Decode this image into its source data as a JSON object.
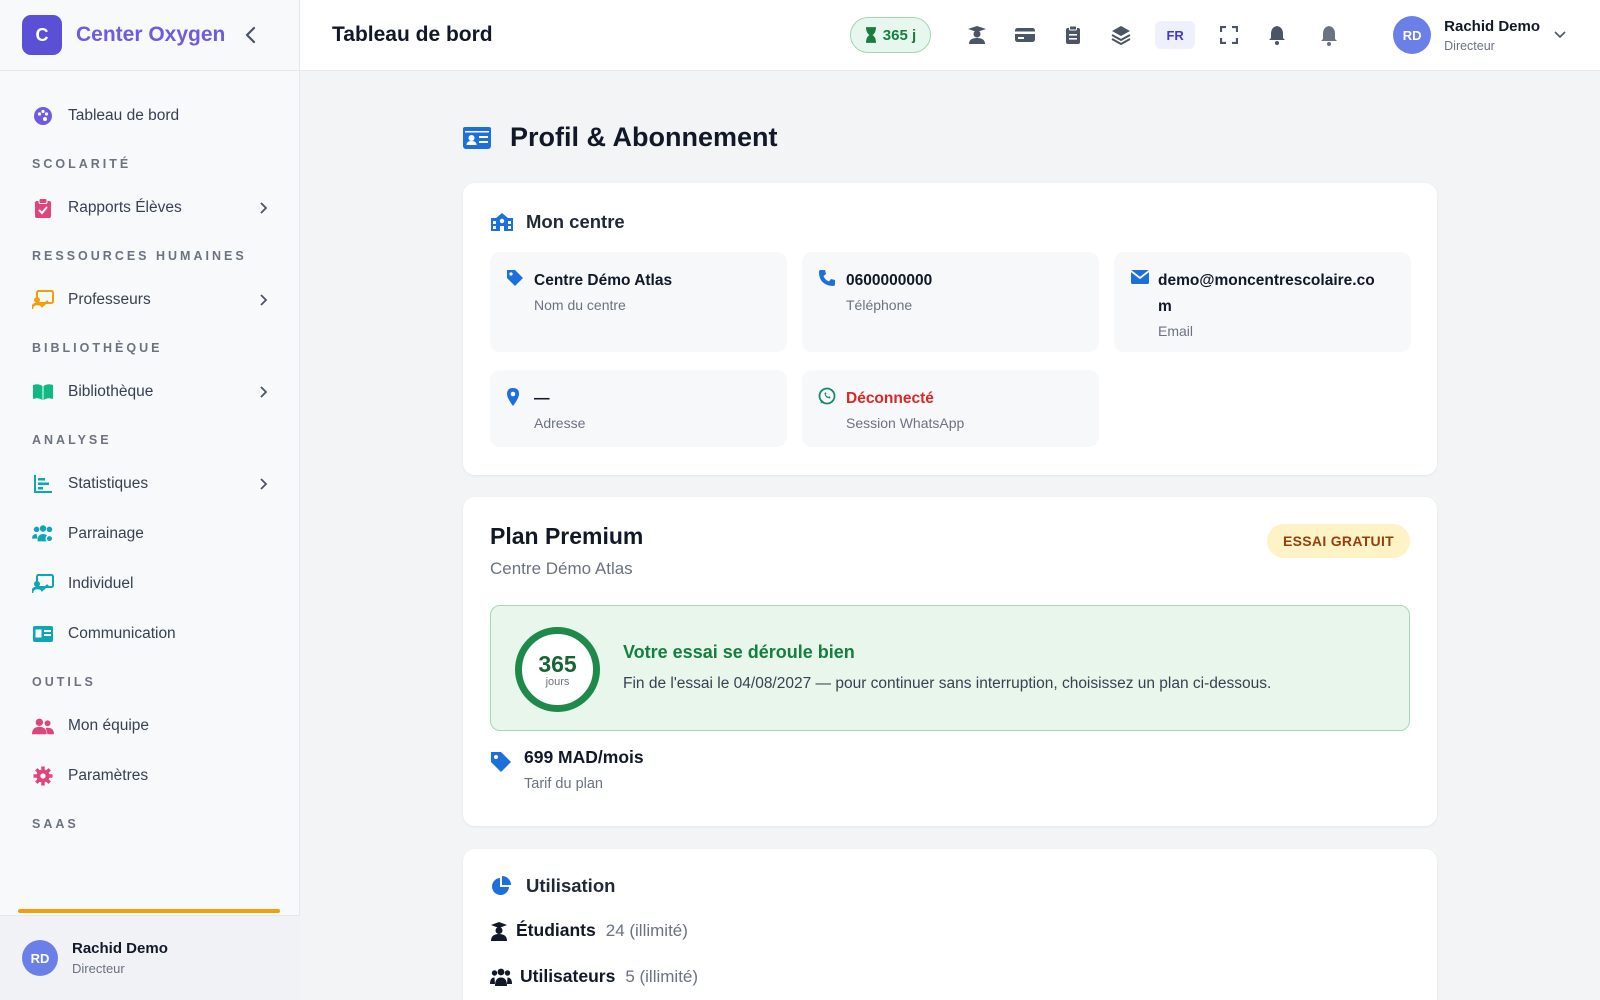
{
  "brand": {
    "logo_letter": "C",
    "name": "Center Oxygen"
  },
  "sidebar": {
    "dashboard": "Tableau de bord",
    "sections": {
      "scolarite": "SCOLARITÉ",
      "rh": "RESSOURCES HUMAINES",
      "biblio": "BIBLIOTHÈQUE",
      "analyse": "ANALYSE",
      "outils": "OUTILS",
      "saas": "SAAS"
    },
    "items": {
      "rapports": "Rapports Élèves",
      "professeurs": "Professeurs",
      "bibliotheque": "Bibliothèque",
      "statistiques": "Statistiques",
      "parrainage": "Parrainage",
      "individuel": "Individuel",
      "communication": "Communication",
      "equipe": "Mon équipe",
      "parametres": "Paramètres"
    },
    "user": {
      "initials": "RD",
      "name": "Rachid Demo",
      "role": "Directeur"
    }
  },
  "topbar": {
    "title": "Tableau de bord",
    "trial_days": "365 j",
    "lang": "FR",
    "user": {
      "initials": "RD",
      "name": "Rachid Demo",
      "role": "Directeur"
    }
  },
  "page": {
    "title": "Profil & Abonnement"
  },
  "centre": {
    "title": "Mon centre",
    "name_value": "Centre Démo Atlas",
    "name_label": "Nom du centre",
    "phone_value": "0600000000",
    "phone_label": "Téléphone",
    "email_value": "demo@moncentrescolaire.co m",
    "email_label": "Email",
    "address_value": "—",
    "address_label": "Adresse",
    "whatsapp_value": "Déconnecté",
    "whatsapp_label": "Session WhatsApp"
  },
  "plan": {
    "name": "Plan Premium",
    "centre": "Centre Démo Atlas",
    "badge": "ESSAI GRATUIT",
    "days": "365",
    "days_unit": "jours",
    "trial_heading": "Votre essai se déroule bien",
    "trial_text": "Fin de l'essai le 04/08/2027 — pour continuer sans interruption, choisissez un plan ci-dessous.",
    "price": "699 MAD/mois",
    "price_label": "Tarif du plan"
  },
  "usage": {
    "title": "Utilisation",
    "students_label": "Étudiants",
    "students_value": "24 (illimité)",
    "users_label": "Utilisateurs",
    "users_value": "5 (illimité)"
  },
  "colors": {
    "accent": "#6d5ce0",
    "primary_blue": "#1d6fdc",
    "success": "#15803d",
    "danger": "#dc2626"
  }
}
